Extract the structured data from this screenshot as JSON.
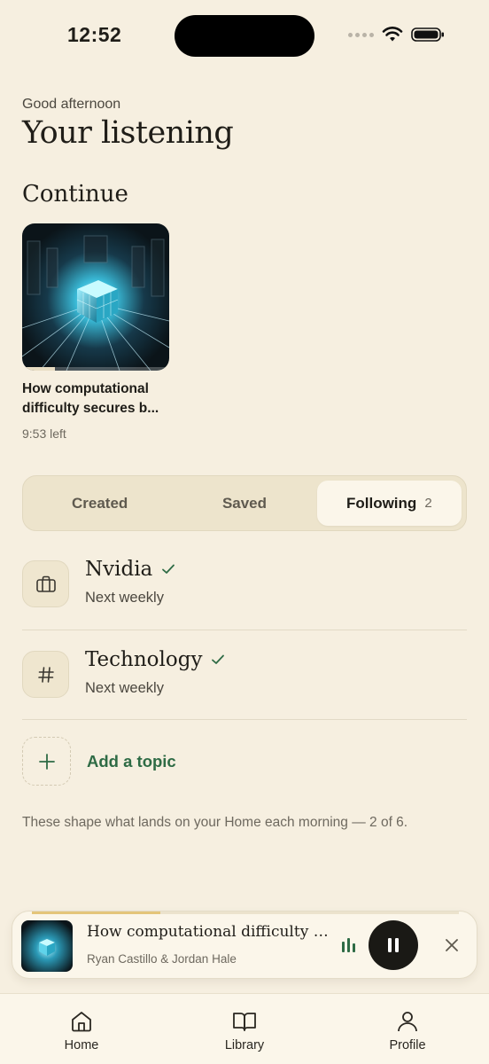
{
  "status": {
    "time": "12:52"
  },
  "header": {
    "greeting": "Good afternoon",
    "title": "Your listening",
    "section_title": "Continue"
  },
  "continue": {
    "title": "How computational difficulty secures b...",
    "meta": "9:53 left",
    "progress": 0.22
  },
  "tabs": [
    {
      "label": "Created",
      "active": false
    },
    {
      "label": "Saved",
      "active": false
    },
    {
      "label": "Following",
      "count": "2",
      "active": true
    }
  ],
  "topics": [
    {
      "name": "Nvidia",
      "sub": "Next weekly",
      "icon": "briefcase-icon"
    },
    {
      "name": "Technology",
      "sub": "Next weekly",
      "icon": "hash-icon"
    }
  ],
  "add_topic": {
    "label": "Add a topic"
  },
  "footnote": "These shape what lands on your Home each morning — 2 of 6.",
  "mini_player": {
    "title": "How computational difficulty s...",
    "subtitle": "Ryan Castillo & Jordan Hale",
    "progress": 0.3
  },
  "nav": [
    {
      "label": "Home",
      "icon": "home-icon"
    },
    {
      "label": "Library",
      "icon": "book-icon",
      "active": true
    },
    {
      "label": "Profile",
      "icon": "person-icon"
    }
  ],
  "colors": {
    "background": "#f6efe0",
    "accent_green": "#2e6b45",
    "progress_gold": "#e4c57a"
  }
}
